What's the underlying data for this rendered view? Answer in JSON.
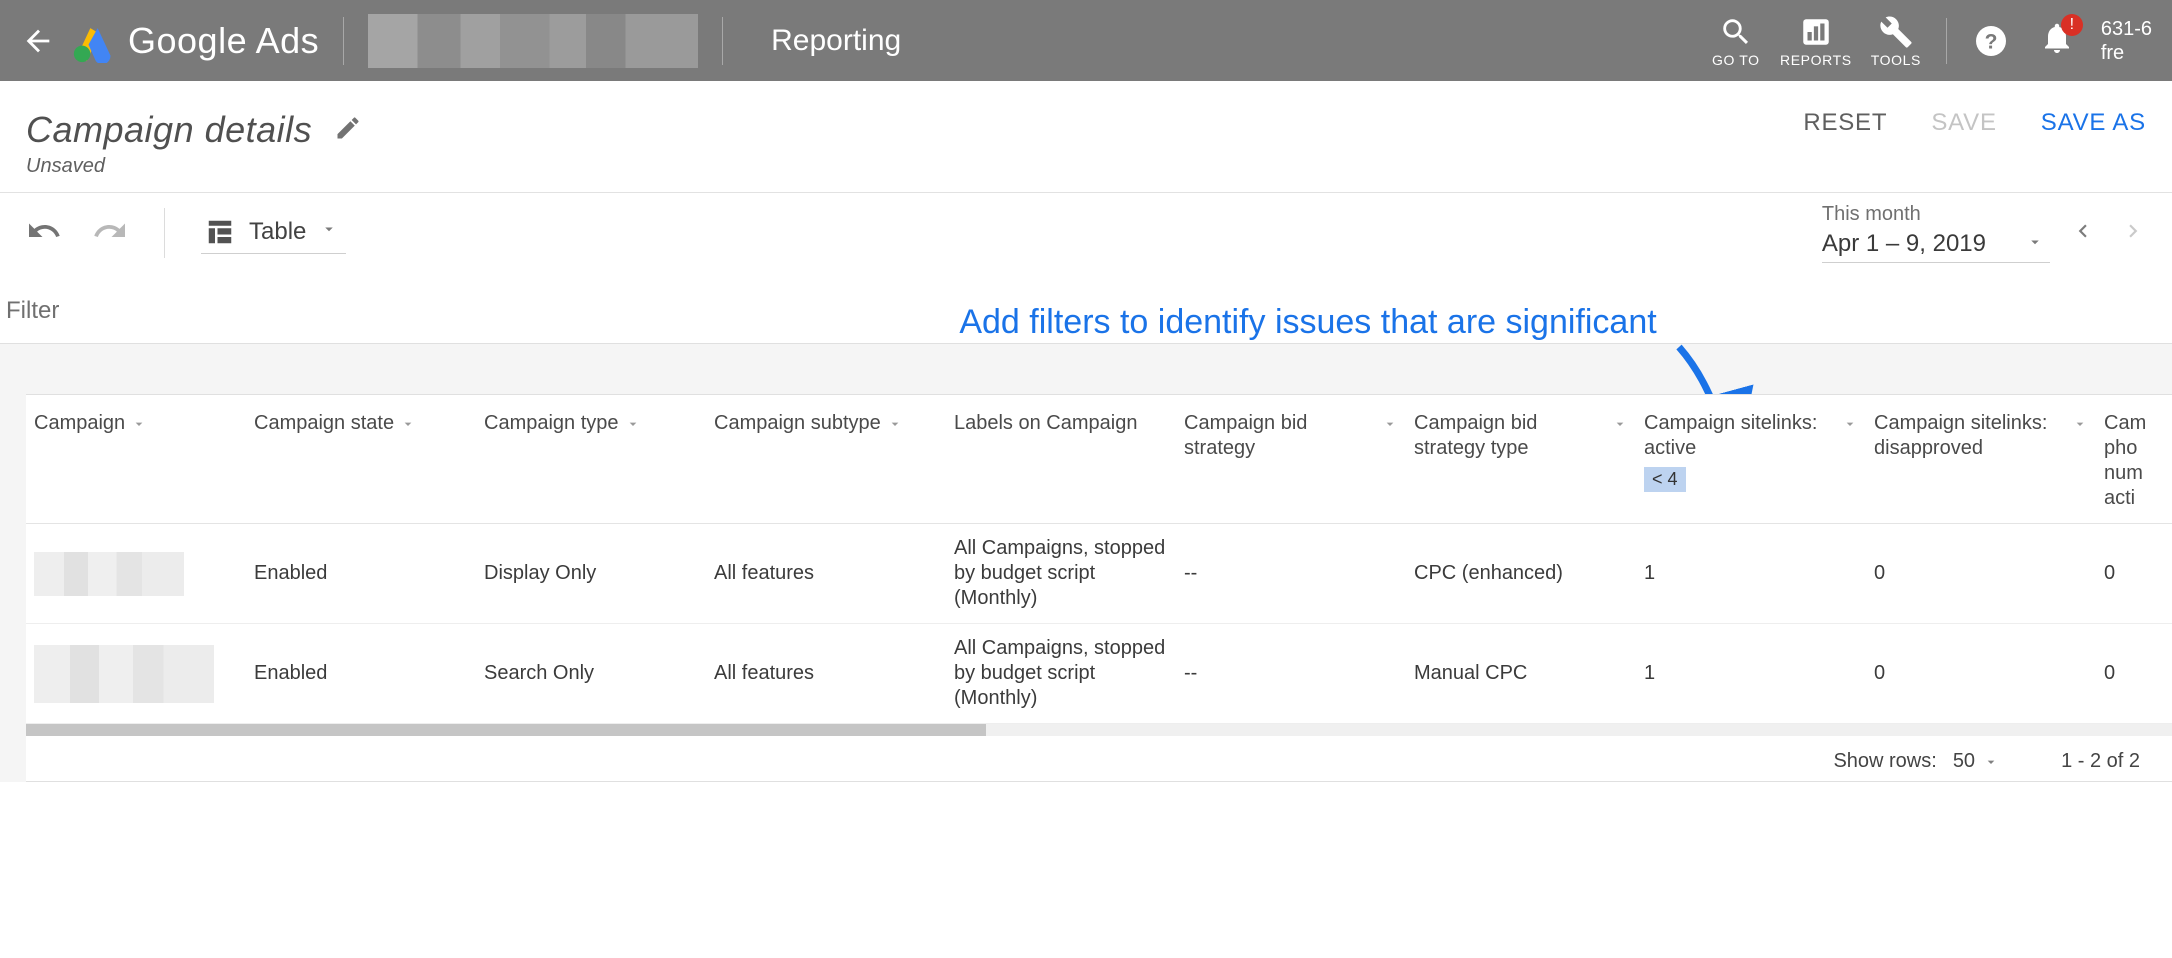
{
  "header": {
    "brand": "Google Ads",
    "section": "Reporting",
    "tools": {
      "goto": "GO TO",
      "reports": "REPORTS",
      "tools": "TOOLS"
    },
    "bell_badge": "!",
    "account_number_partial": "631-6",
    "account_name_partial": "fre"
  },
  "report": {
    "title": "Campaign details",
    "status": "Unsaved",
    "actions": {
      "reset": "RESET",
      "save": "SAVE",
      "save_as": "SAVE AS"
    }
  },
  "toolbar": {
    "view_label": "Table",
    "date_preset": "This month",
    "date_range": "Apr 1 – 9, 2019"
  },
  "filter": {
    "label": "Filter",
    "annotation": "Add filters to identify issues that are significant"
  },
  "table": {
    "columns": [
      {
        "label": "Campaign"
      },
      {
        "label": "Campaign state"
      },
      {
        "label": "Campaign type"
      },
      {
        "label": "Campaign subtype"
      },
      {
        "label": "Labels on Campaign"
      },
      {
        "label": "Campaign bid strategy"
      },
      {
        "label": "Campaign bid strategy type"
      },
      {
        "label": "Campaign sitelinks: active",
        "filter": "< 4"
      },
      {
        "label": "Campaign sitelinks: disapproved"
      },
      {
        "label": "Campaign phone numbers: active"
      }
    ],
    "rows": [
      {
        "state": "Enabled",
        "type": "Display Only",
        "subtype": "All features",
        "labels": "All Campaigns, stopped by budget script (Monthly)",
        "bid_strategy": "--",
        "bid_strategy_type": "CPC (enhanced)",
        "sitelinks_active": "1",
        "sitelinks_disapproved": "0",
        "phone_active": "0"
      },
      {
        "state": "Enabled",
        "type": "Search Only",
        "subtype": "All features",
        "labels": "All Campaigns, stopped by budget script (Monthly)",
        "bid_strategy": "--",
        "bid_strategy_type": "Manual CPC",
        "sitelinks_active": "1",
        "sitelinks_disapproved": "0",
        "phone_active": "0"
      }
    ]
  },
  "pager": {
    "show_rows_label": "Show rows:",
    "rows_value": "50",
    "range_text": "1 - 2 of 2"
  }
}
